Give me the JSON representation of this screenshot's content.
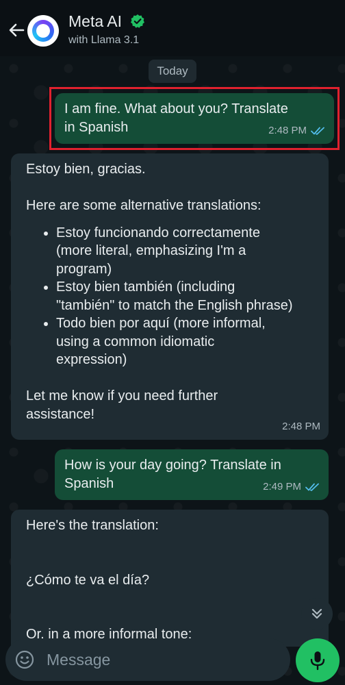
{
  "header": {
    "title": "Meta AI",
    "subtitle": "with Llama 3.1",
    "icons": [
      "back-arrow-icon",
      "meta-ai-logo-icon",
      "verified-check-icon"
    ]
  },
  "date_chip": "Today",
  "messages": [
    {
      "direction": "outgoing",
      "lines": [
        "I am fine. What about you? Translate",
        "in Spanish"
      ],
      "time": "2:48 PM",
      "status": "read"
    },
    {
      "direction": "incoming",
      "intro": "Estoy bien, gracias.",
      "lead": "Here are some alternative translations:",
      "bullets": [
        [
          "Estoy funcionando correctamente",
          "(more literal, emphasizing I'm a",
          "program)"
        ],
        [
          "Estoy bien también (including",
          "\"también\" to match the English phrase)"
        ],
        [
          "Todo bien por aquí (more informal,",
          "using a common idiomatic",
          "expression)"
        ]
      ],
      "closing": [
        "Let me know if you need further",
        "assistance!"
      ],
      "time": "2:48 PM"
    },
    {
      "direction": "outgoing",
      "lines": [
        "How is your day going? Translate in",
        "Spanish"
      ],
      "time": "2:49 PM",
      "status": "read"
    },
    {
      "direction": "incoming",
      "line1": "Here's the translation:",
      "line2": "¿Cómo te va el día?",
      "line3": "Or, in a more informal tone:"
    }
  ],
  "input": {
    "placeholder": "Message"
  },
  "colors": {
    "outgoing_bubble": "#144d37",
    "incoming_bubble": "#1f2c33",
    "accent_green": "#21c063",
    "read_ticks": "#53bdeb",
    "highlight": "#e0212e"
  }
}
